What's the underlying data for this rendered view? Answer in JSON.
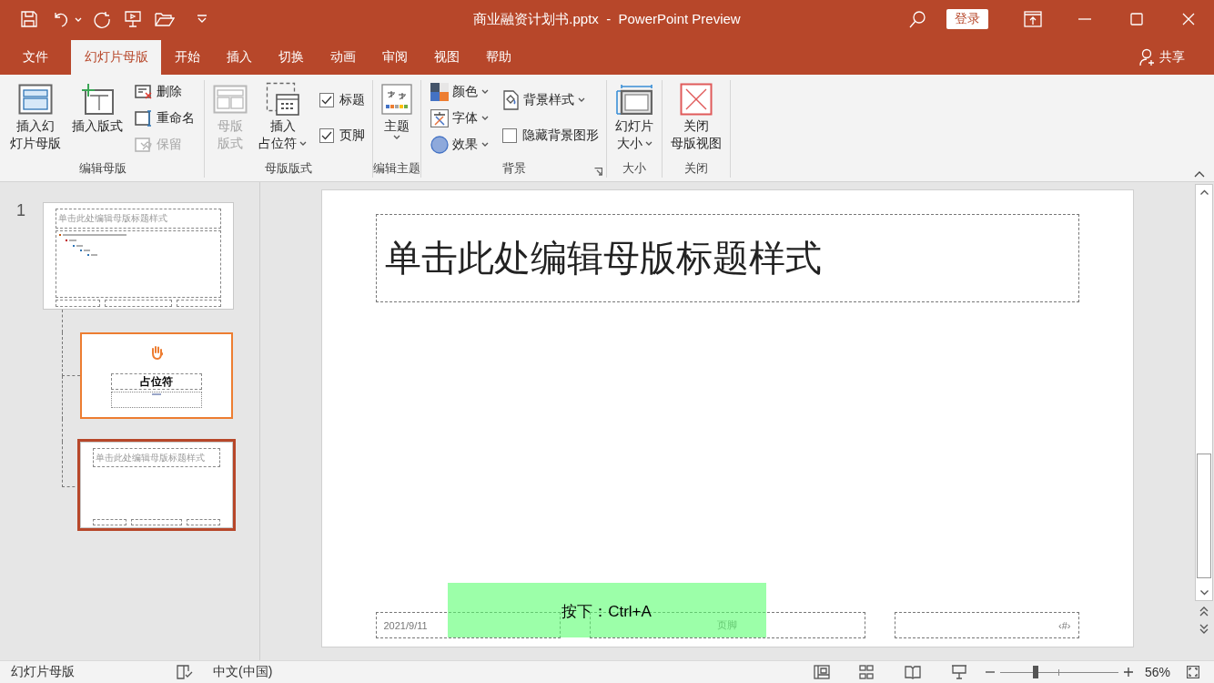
{
  "title_bar": {
    "file_title": "商业融资计划书.pptx  -  PowerPoint Preview",
    "sign_in": "登录"
  },
  "menu_tabs": [
    {
      "label": "文件",
      "selected": false
    },
    {
      "label": "幻灯片母版",
      "selected": true
    },
    {
      "label": "开始",
      "selected": false
    },
    {
      "label": "插入",
      "selected": false
    },
    {
      "label": "切换",
      "selected": false
    },
    {
      "label": "动画",
      "selected": false
    },
    {
      "label": "审阅",
      "selected": false
    },
    {
      "label": "视图",
      "selected": false
    },
    {
      "label": "帮助",
      "selected": false
    }
  ],
  "share": "共享",
  "ribbon_groups": [
    {
      "label": "编辑母版",
      "launcher": false,
      "items": [
        {
          "kind": "large",
          "lines": [
            "插入幻",
            "灯片母版"
          ],
          "disabled": false,
          "dropdown": false
        },
        {
          "kind": "large",
          "lines": [
            "插入版式"
          ],
          "disabled": false,
          "dropdown": false
        },
        {
          "kind": "small",
          "label": "删除",
          "disabled": false,
          "dropdown": false
        },
        {
          "kind": "small",
          "label": "重命名",
          "disabled": false,
          "dropdown": false
        },
        {
          "kind": "small",
          "label": "保留",
          "disabled": true,
          "dropdown": false
        }
      ]
    },
    {
      "label": "母版版式",
      "launcher": false,
      "items": [
        {
          "kind": "large",
          "lines": [
            "母版",
            "版式"
          ],
          "disabled": true,
          "dropdown": false
        },
        {
          "kind": "large",
          "lines": [
            "插入",
            "占位符"
          ],
          "disabled": false,
          "dropdown": true
        },
        {
          "kind": "check",
          "label": "标题",
          "checked": true
        },
        {
          "kind": "check",
          "label": "页脚",
          "checked": true
        }
      ]
    },
    {
      "label": "编辑主题",
      "launcher": false,
      "items": [
        {
          "kind": "large",
          "lines": [
            "主题"
          ],
          "disabled": false,
          "dropdown": true
        }
      ]
    },
    {
      "label": "背景",
      "launcher": true,
      "items": [
        {
          "kind": "small",
          "label": "颜色",
          "disabled": false,
          "dropdown": true
        },
        {
          "kind": "small",
          "label": "字体",
          "disabled": false,
          "dropdown": true
        },
        {
          "kind": "small",
          "label": "效果",
          "disabled": false,
          "dropdown": true
        },
        {
          "kind": "small",
          "label": "背景样式",
          "disabled": false,
          "dropdown": true
        },
        {
          "kind": "check",
          "label": "隐藏背景图形",
          "checked": false
        }
      ]
    },
    {
      "label": "大小",
      "launcher": false,
      "items": [
        {
          "kind": "large",
          "lines": [
            "幻灯片",
            "大小"
          ],
          "disabled": false,
          "dropdown": true
        }
      ]
    },
    {
      "label": "关闭",
      "launcher": false,
      "items": [
        {
          "kind": "large",
          "lines": [
            "关闭",
            "母版视图"
          ],
          "disabled": false,
          "dropdown": false
        }
      ]
    }
  ],
  "slide_thumbnails": [
    {
      "number": "1",
      "kind": "master",
      "title": "单击此处编辑母版标题样式",
      "selected": false,
      "hovered": false,
      "children": [
        {
          "kind": "title_layout",
          "title": "占位符",
          "selected": false,
          "hovered": true
        },
        {
          "kind": "title_only",
          "title": "单击此处编辑母版标题样式",
          "selected": true,
          "hovered": false
        }
      ]
    }
  ],
  "slide": {
    "title": "单击此处编辑母版标题样式",
    "footers": [
      {
        "kind": "date",
        "text": "2021/9/11"
      },
      {
        "kind": "footer",
        "text": "页脚"
      },
      {
        "kind": "number",
        "text": "‹#›"
      }
    ]
  },
  "key_hint": "按下：Ctrl+A",
  "status_bar": {
    "mode": "幻灯片母版",
    "language": "中文(中国)",
    "zoom": "56%",
    "zoom_slider": {
      "level": 0.3
    }
  }
}
